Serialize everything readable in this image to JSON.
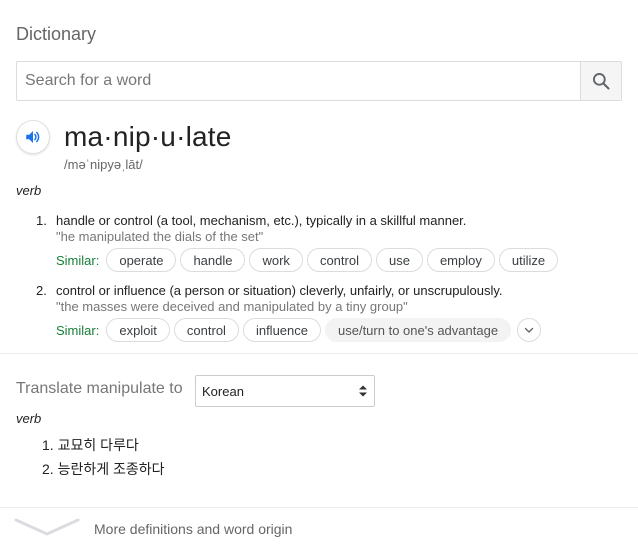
{
  "panel": {
    "title": "Dictionary"
  },
  "search": {
    "placeholder": "Search for a word"
  },
  "entry": {
    "word": "ma·nip·u·late",
    "pronunciation": "/məˈnipyəˌlāt/",
    "part_of_speech": "verb",
    "definitions": [
      {
        "number": "1.",
        "text": "handle or control (a tool, mechanism, etc.), typically in a skillful manner.",
        "example": "\"he manipulated the dials of the set\"",
        "similar_label": "Similar:",
        "similar": [
          "operate",
          "handle",
          "work",
          "control",
          "use",
          "employ",
          "utilize"
        ]
      },
      {
        "number": "2.",
        "text": "control or influence (a person or situation) cleverly, unfairly, or unscrupulously.",
        "example": "\"the masses were deceived and manipulated by a tiny group\"",
        "similar_label": "Similar:",
        "similar": [
          "exploit",
          "control",
          "influence",
          "use/turn to one's advantage"
        ]
      }
    ]
  },
  "translate": {
    "label": "Translate manipulate to",
    "selected_language": "Korean",
    "part_of_speech": "verb",
    "items": [
      {
        "number": "1.",
        "text": "교묘히 다루다"
      },
      {
        "number": "2.",
        "text": "능란하게 조종하다"
      }
    ]
  },
  "footer": {
    "text": "More definitions and word origin"
  },
  "colors": {
    "similar_label": "#188038",
    "accent_blue": "#1a73e8"
  }
}
